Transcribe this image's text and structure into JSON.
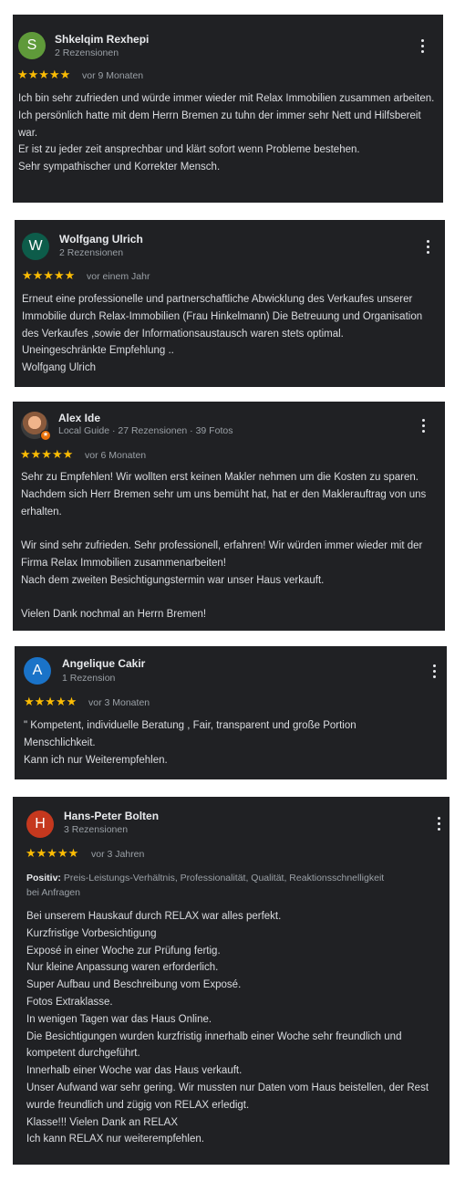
{
  "reviews": [
    {
      "initial": "S",
      "avatar_color": "#5f9a3a",
      "name": "Shkelqim Rexhepi",
      "sub": "2 Rezensionen",
      "stars": "★★★★★",
      "time": "vor 9 Monaten",
      "text": "Ich bin sehr zufrieden und würde immer wieder mit Relax Immobilien zusammen arbeiten.\nIch persönlich hatte mit dem Herrn Bremen zu tuhn der immer sehr Nett und Hilfsbereit war.\nEr ist zu jeder zeit ansprechbar und klärt sofort wenn Probleme bestehen.\nSehr sympathischer und Korrekter Mensch."
    },
    {
      "initial": "W",
      "avatar_color": "#0d5c4a",
      "name": "Wolfgang Ulrich",
      "sub": "2 Rezensionen",
      "stars": "★★★★★",
      "time": "vor einem Jahr",
      "text": "Erneut eine professionelle und partnerschaftliche Abwicklung des Verkaufes unserer Immobilie durch Relax-Immobilien (Frau Hinkelmann) Die Betreuung und Organisation des Verkaufes ,sowie der Informationsaustausch waren stets optimal.\nUneingeschränkte Empfehlung ..\nWolfgang Ulrich"
    },
    {
      "initial": "",
      "avatar_color": "#3b3b3b",
      "name": "Alex Ide",
      "sub": "Local Guide · 27 Rezensionen · 39 Fotos",
      "stars": "★★★★★",
      "time": "vor 6 Monaten",
      "text": "Sehr zu Empfehlen! Wir wollten erst keinen Makler nehmen um die Kosten zu sparen. Nachdem sich Herr Bremen sehr um uns bemüht hat, hat er den Maklerauftrag von uns erhalten.\n\nWir sind sehr zufrieden. Sehr professionell, erfahren! Wir würden immer wieder mit der Firma Relax Immobilien zusammenarbeiten!\nNach dem zweiten Besichtigungstermin war unser Haus verkauft.\n\nVielen Dank nochmal an Herrn Bremen!"
    },
    {
      "initial": "A",
      "avatar_color": "#1a73c8",
      "name": "Angelique Cakir",
      "sub": "1 Rezension",
      "stars": "★★★★★",
      "time": "vor 3 Monaten",
      "text": "\" Kompetent, individuelle Beratung , Fair, transparent und große Portion Menschlichkeit.\nKann ich nur Weiterempfehlen."
    },
    {
      "initial": "H",
      "avatar_color": "#c5381e",
      "name": "Hans-Peter Bolten",
      "sub": "3 Rezensionen",
      "stars": "★★★★★",
      "time": "vor 3 Jahren",
      "positive_label": "Positiv:",
      "positive_text": "Preis-Leistungs-Verhältnis, Professionalität, Qualität, Reaktionsschnelligkeit bei Anfragen",
      "text": "Bei unserem Hauskauf durch RELAX war alles perfekt.\nKurzfristige Vorbesichtigung\nExposé in einer Woche zur Prüfung fertig.\nNur kleine Anpassung waren erforderlich.\nSuper Aufbau und Beschreibung vom Exposé.\nFotos Extraklasse.\nIn wenigen Tagen war das Haus Online.\nDie Besichtigungen wurden kurzfristig innerhalb einer Woche sehr freundlich und kompetent durchgeführt.\nInnerhalb einer Woche war das Haus verkauft.\nUnser Aufwand war sehr gering. Wir mussten nur Daten vom Haus beistellen, der Rest wurde freundlich und zügig von RELAX erledigt.\nKlasse!!! Vielen Dank an RELAX\nIch kann RELAX nur weiterempfehlen."
    }
  ]
}
